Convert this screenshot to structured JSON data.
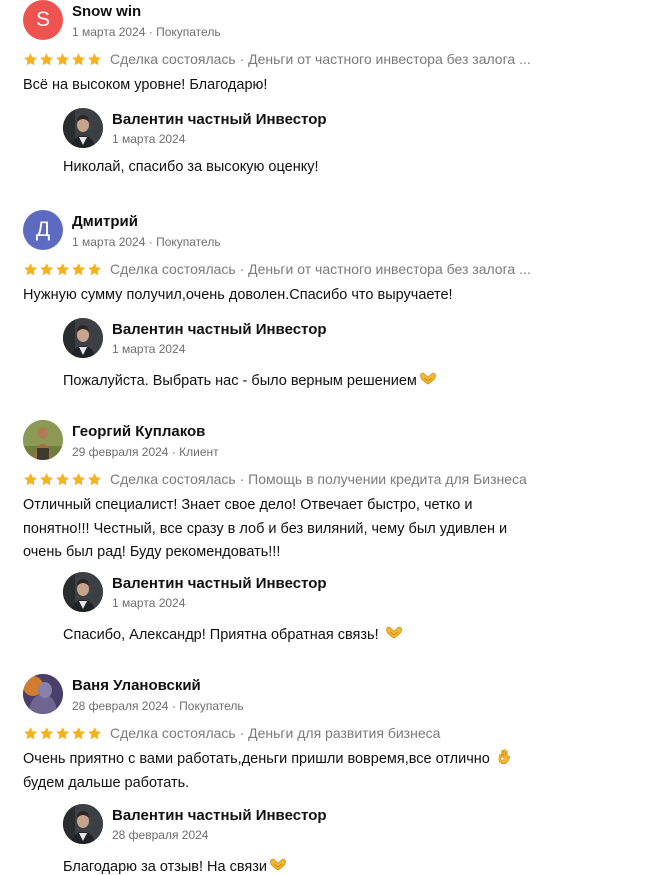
{
  "colors": {
    "star": "#f6b21b",
    "avatar_s": "#ef5350",
    "avatar_d": "#5c6bc0"
  },
  "reviews": [
    {
      "initial": "S",
      "author": "Snow win",
      "date": "1 марта 2024",
      "role": "Покупатель",
      "deal": "Сделка состоялась · Деньги от частного инвестора без залога ...",
      "text": "Всё на высоком уровне! Благодарю!",
      "reply": {
        "name": "Валентин частный Инвестор",
        "date": "1 марта 2024",
        "text": "Николай, спасибо за высокую оценку!"
      }
    },
    {
      "initial": "Д",
      "author": "Дмитрий",
      "date": "1 марта 2024",
      "role": "Покупатель",
      "deal": "Сделка состоялась · Деньги от частного инвестора без залога ...",
      "text": "Нужную сумму получил,очень доволен.Спасибо что выручаете!",
      "reply": {
        "name": "Валентин частный Инвестор",
        "date": "1 марта 2024",
        "text": "Пожалуйста. Выбрать нас - было верным решением"
      }
    },
    {
      "author": "Георгий Куплаков",
      "date": "29 февраля 2024",
      "role": "Клиент",
      "deal": "Сделка состоялась · Помощь в получении кредита для Бизнеса",
      "text_lines": [
        "Отличный специалист! Знает свое дело! Отвечает быстро, четко и",
        "понятно!!! Честный, все сразу в лоб и без виляний, чему был удивлен и",
        "очень был рад! Буду рекомендовать!!!"
      ],
      "reply": {
        "name": "Валентин частный Инвестор",
        "date": "1 марта 2024",
        "text": "Спасибо, Александр! Приятна обратная связь!"
      }
    },
    {
      "author": "Ваня Улановский",
      "date": "28 февраля 2024",
      "role": "Покупатель",
      "deal": "Сделка состоялась · Деньги для развития бизнеса",
      "text_lines": [
        "Очень приятно с вами работать,деньги пришли вовремя,все отлично",
        "будем дальше работать."
      ],
      "reply": {
        "name": "Валентин частный Инвестор",
        "date": "28 февраля 2024",
        "text": "Благодарю за отзыв! На связи"
      }
    }
  ]
}
